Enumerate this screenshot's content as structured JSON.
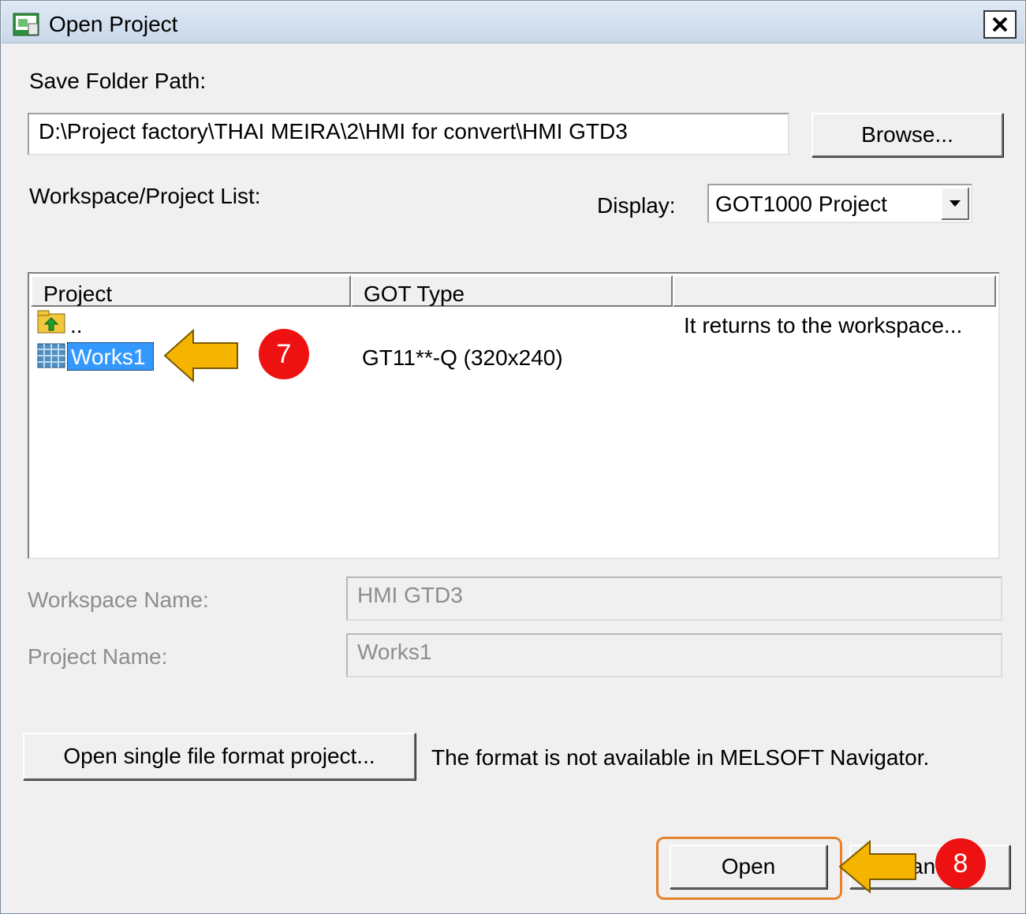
{
  "window": {
    "title": "Open Project",
    "close_glyph": "✕"
  },
  "save_folder": {
    "label": "Save Folder Path:",
    "value": "D:\\Project factory\\THAI MEIRA\\2\\HMI for convert\\HMI GTD3",
    "browse_label": "Browse..."
  },
  "list_section": {
    "label": "Workspace/Project List:",
    "display_label": "Display:",
    "display_value": "GOT1000 Project"
  },
  "table": {
    "columns": [
      "Project",
      "GOT Type",
      ""
    ],
    "rows": [
      {
        "project": "..",
        "got_type": "",
        "note": "It returns to the workspace...",
        "icon": "folder-up-icon"
      },
      {
        "project": "Works1",
        "got_type": "GT11**-Q (320x240)",
        "note": "",
        "icon": "project-icon",
        "selected": true
      }
    ]
  },
  "workspace_name": {
    "label": "Workspace Name:",
    "value": "HMI GTD3"
  },
  "project_name": {
    "label": "Project Name:",
    "value": "Works1"
  },
  "single_file": {
    "button_label": "Open single file format project...",
    "note": "The format is not available in MELSOFT Navigator."
  },
  "footer": {
    "open_label": "Open",
    "cancel_label": "an"
  },
  "annotations": {
    "step7": "7",
    "step8": "8",
    "arrow_color": "#f5b400",
    "badge_color": "#ee1111",
    "highlight_color": "#e6822a"
  }
}
